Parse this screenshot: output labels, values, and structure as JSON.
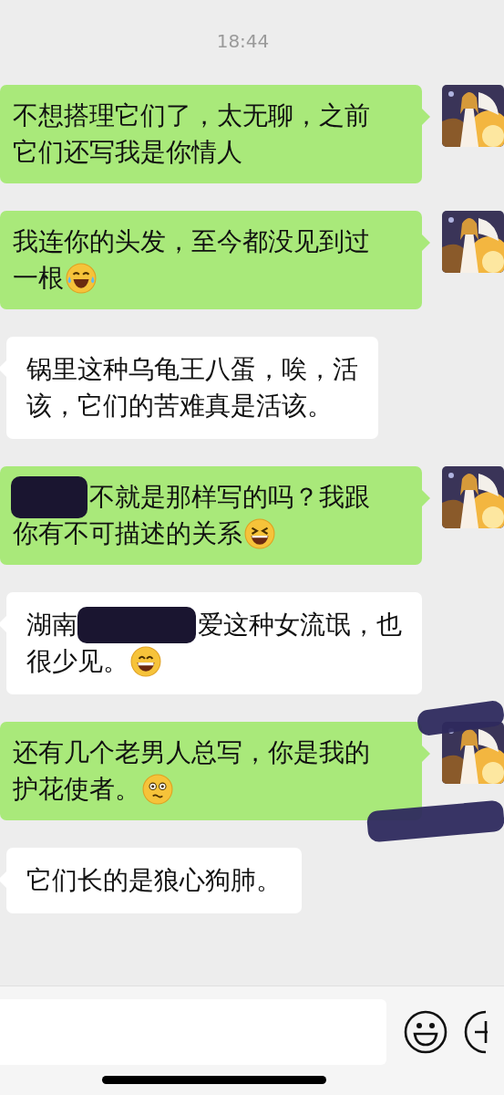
{
  "time": "18:44",
  "messages": [
    {
      "outgoing": true,
      "lines": [
        [
          {
            "kind": "text",
            "text": "不想搭理它们了，太无聊，之前"
          }
        ],
        [
          {
            "kind": "text",
            "text": "它们还写我是你情人"
          }
        ]
      ]
    },
    {
      "outgoing": true,
      "lines": [
        [
          {
            "kind": "text",
            "text": "我连你的头发，至今都没见到过"
          }
        ],
        [
          {
            "kind": "text",
            "text": "一根"
          },
          {
            "kind": "tears"
          }
        ]
      ]
    },
    {
      "outgoing": false,
      "lines": [
        [
          {
            "kind": "text",
            "text": "锅里这种乌龟王八蛋，唉，活"
          }
        ],
        [
          {
            "kind": "text",
            "text": "该，它们的苦难真是活该。"
          }
        ]
      ]
    },
    {
      "outgoing": true,
      "lines": [
        [
          {
            "kind": "redaction"
          },
          {
            "kind": "text",
            "text": "不就是那样写的吗？我跟"
          }
        ],
        [
          {
            "kind": "text",
            "text": "你有不可描述的关系"
          },
          {
            "kind": "squint"
          }
        ]
      ]
    },
    {
      "outgoing": false,
      "lines": [
        [
          {
            "kind": "text",
            "text": "湖南"
          },
          {
            "kind": "redaction"
          },
          {
            "kind": "text",
            "text": "爱这种女流氓，也"
          }
        ],
        [
          {
            "kind": "text",
            "text": "很少见。"
          },
          {
            "kind": "grin"
          }
        ]
      ]
    },
    {
      "outgoing": true,
      "scribbled": true,
      "lines": [
        [
          {
            "kind": "text",
            "text": "还有几个老男人总写，你是我的"
          }
        ],
        [
          {
            "kind": "text",
            "text": "护花使者。"
          },
          {
            "kind": "flushed"
          }
        ]
      ]
    },
    {
      "outgoing": false,
      "lines": [
        [
          {
            "kind": "text",
            "text": "它们长的是狼心狗肺。"
          }
        ]
      ]
    }
  ]
}
